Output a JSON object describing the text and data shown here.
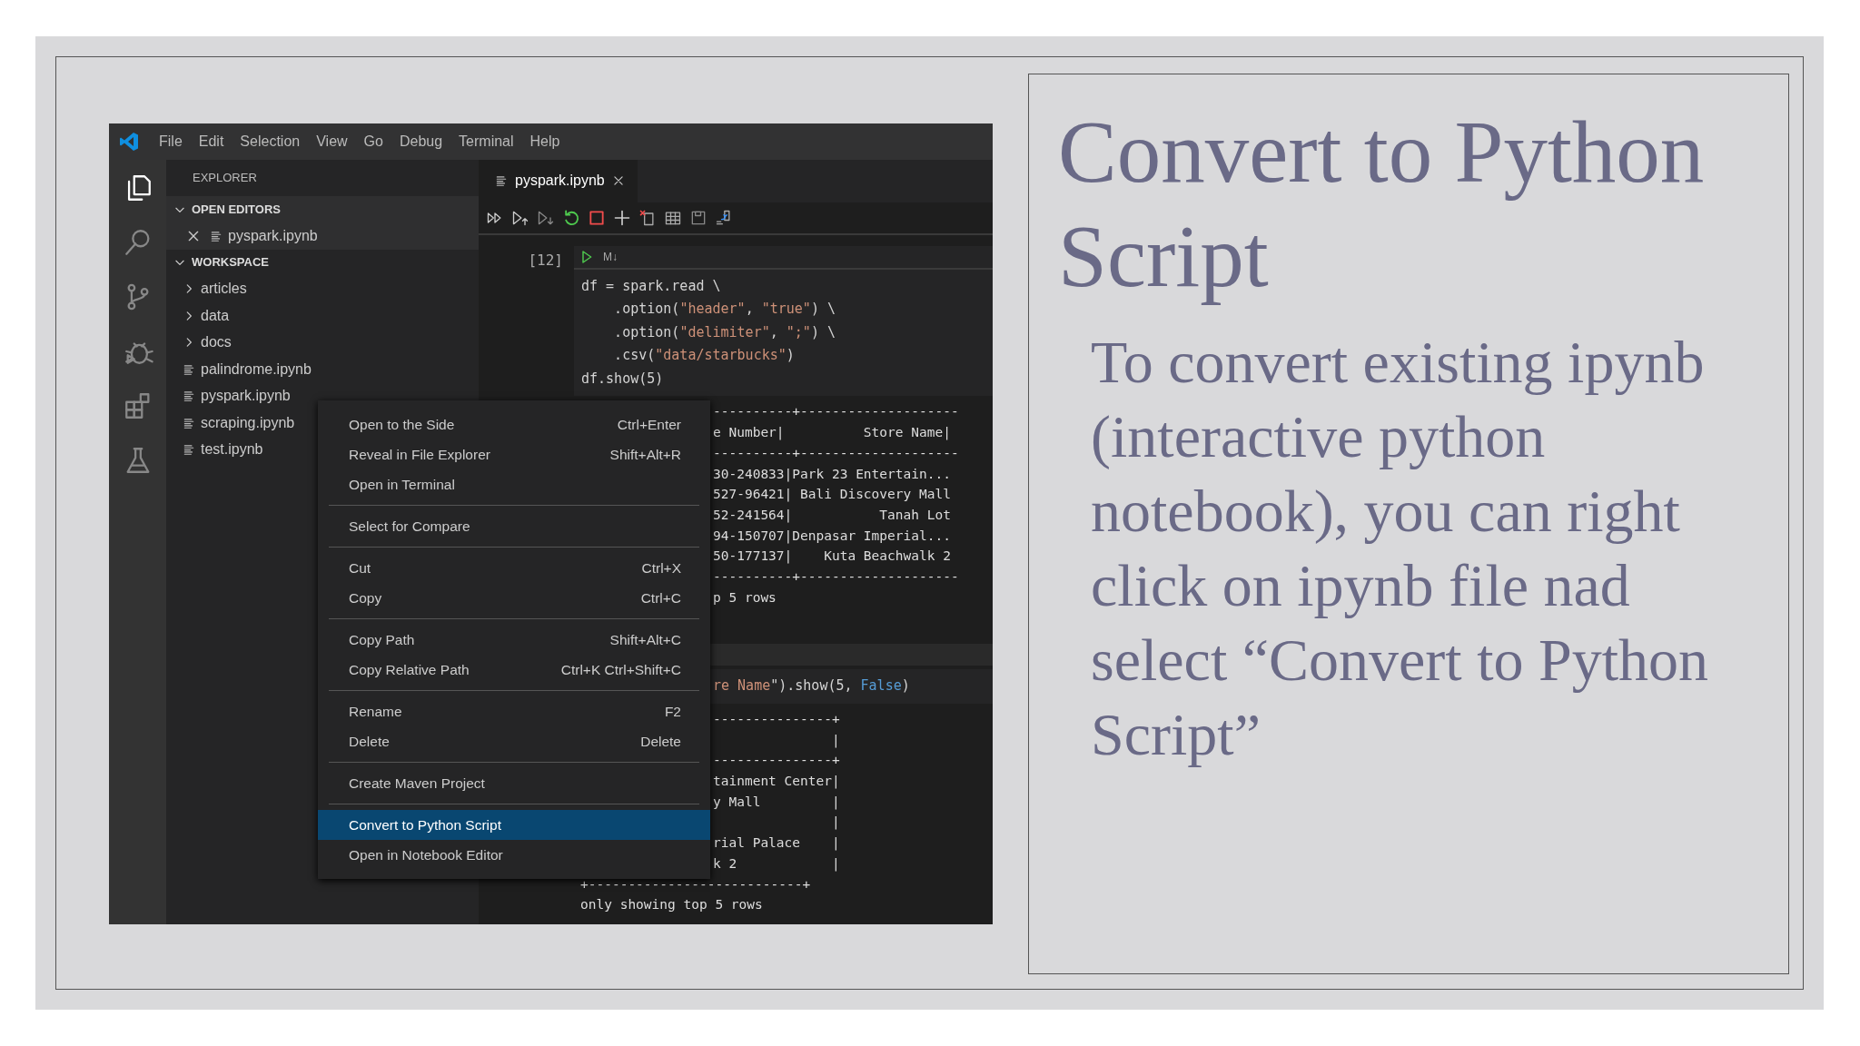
{
  "window": {
    "menu": [
      "File",
      "Edit",
      "Selection",
      "View",
      "Go",
      "Debug",
      "Terminal",
      "Help"
    ]
  },
  "sidebar": {
    "title": "EXPLORER",
    "sections": [
      {
        "title": "OPEN EDITORS",
        "expanded": true,
        "items": [
          {
            "label": "pyspark.ipynb",
            "kind": "open-editor"
          }
        ]
      },
      {
        "title": "WORKSPACE",
        "expanded": true,
        "items": [
          {
            "label": "articles",
            "kind": "folder",
            "expanded": false
          },
          {
            "label": "data",
            "kind": "folder",
            "expanded": false
          },
          {
            "label": "docs",
            "kind": "folder",
            "expanded": false
          },
          {
            "label": "palindrome.ipynb",
            "kind": "file"
          },
          {
            "label": "pyspark.ipynb",
            "kind": "file"
          },
          {
            "label": "scraping.ipynb",
            "kind": "file"
          },
          {
            "label": "test.ipynb",
            "kind": "file"
          }
        ]
      }
    ]
  },
  "editor": {
    "tabs": [
      {
        "label": "pyspark.ipynb",
        "selected": true
      }
    ],
    "cells": [
      {
        "prompt": "[12]",
        "cell_type": "M↓",
        "code": [
          [
            {
              "text": "df = spark.read \\",
              "kind": "plain"
            }
          ],
          [
            {
              "text": "    .option(",
              "kind": "plain"
            },
            {
              "text": "\"header\"",
              "kind": "string"
            },
            {
              "text": ", ",
              "kind": "plain"
            },
            {
              "text": "\"true\"",
              "kind": "string"
            },
            {
              "text": ") \\",
              "kind": "plain"
            }
          ],
          [
            {
              "text": "    .option(",
              "kind": "plain"
            },
            {
              "text": "\"delimiter\"",
              "kind": "string"
            },
            {
              "text": ", ",
              "kind": "plain"
            },
            {
              "text": "\";\"",
              "kind": "string"
            },
            {
              "text": ") \\",
              "kind": "plain"
            }
          ],
          [
            {
              "text": "    .csv(",
              "kind": "plain"
            },
            {
              "text": "\"data/starbucks\"",
              "kind": "string"
            },
            {
              "text": ")",
              "kind": "plain"
            }
          ],
          [
            {
              "text": "df.show(5)",
              "kind": "plain"
            }
          ]
        ],
        "output": [
          {
            "text": "----------+--------------------",
            "kind": "clipped"
          },
          {
            "text": "e Number|          Store Name|",
            "kind": "clipped"
          },
          {
            "text": "----------+--------------------",
            "kind": "clipped"
          },
          {
            "text": "30-240833|Park 23 Entertain...",
            "kind": "clipped"
          },
          {
            "text": "527-96421| Bali Discovery Mall",
            "kind": "clipped"
          },
          {
            "text": "52-241564|           Tanah Lot",
            "kind": "clipped"
          },
          {
            "text": "94-150707|Denpasar Imperial...",
            "kind": "clipped"
          },
          {
            "text": "50-177137|    Kuta Beachwalk 2",
            "kind": "clipped"
          },
          {
            "text": "----------+--------------------",
            "kind": "clipped"
          },
          {
            "text": "p 5 rows",
            "kind": "clipped"
          }
        ]
      },
      {
        "code": [
          [
            {
              "text": "re Name",
              "kind": "string"
            },
            {
              "text": "\").show(5, ",
              "kind": "plain"
            },
            {
              "text": "False",
              "kind": "keyword"
            },
            {
              "text": ")",
              "kind": "plain"
            }
          ]
        ],
        "output": [
          {
            "text": "---------------+",
            "kind": "clipped"
          },
          {
            "text": "               |",
            "kind": "clipped"
          },
          {
            "text": "---------------+",
            "kind": "clipped"
          },
          {
            "text": "tainment Center|",
            "kind": "clipped"
          },
          {
            "text": "y Mall         |",
            "kind": "clipped"
          },
          {
            "text": "               |",
            "kind": "clipped"
          },
          {
            "text": "rial Palace    |",
            "kind": "clipped"
          },
          {
            "text": "k 2            |",
            "kind": "clipped"
          },
          {
            "text": "+---------------------------+",
            "kind": "full"
          },
          {
            "text": "only showing top 5 rows",
            "kind": "full"
          }
        ]
      }
    ]
  },
  "context_menu": {
    "groups": [
      [
        {
          "label": "Open to the Side",
          "shortcut": "Ctrl+Enter",
          "selected": false
        },
        {
          "label": "Reveal in File Explorer",
          "shortcut": "Shift+Alt+R",
          "selected": false
        },
        {
          "label": "Open in Terminal",
          "selected": false
        }
      ],
      [
        {
          "label": "Select for Compare",
          "selected": false
        }
      ],
      [
        {
          "label": "Cut",
          "shortcut": "Ctrl+X",
          "selected": false
        },
        {
          "label": "Copy",
          "shortcut": "Ctrl+C",
          "selected": false
        }
      ],
      [
        {
          "label": "Copy Path",
          "shortcut": "Shift+Alt+C",
          "selected": false
        },
        {
          "label": "Copy Relative Path",
          "shortcut": "Ctrl+K Ctrl+Shift+C",
          "selected": false
        }
      ],
      [
        {
          "label": "Rename",
          "shortcut": "F2",
          "selected": false
        },
        {
          "label": "Delete",
          "shortcut": "Delete",
          "selected": false
        }
      ],
      [
        {
          "label": "Create Maven Project",
          "selected": false
        }
      ],
      [
        {
          "label": "Convert to Python Script",
          "selected": true
        },
        {
          "label": "Open in Notebook Editor",
          "selected": false
        }
      ]
    ]
  },
  "slide": {
    "title": "Convert to Python Script",
    "body": "To convert existing ipynb (interactive python notebook), you can right click on ipynb file nad select “Convert to Python Script”"
  }
}
